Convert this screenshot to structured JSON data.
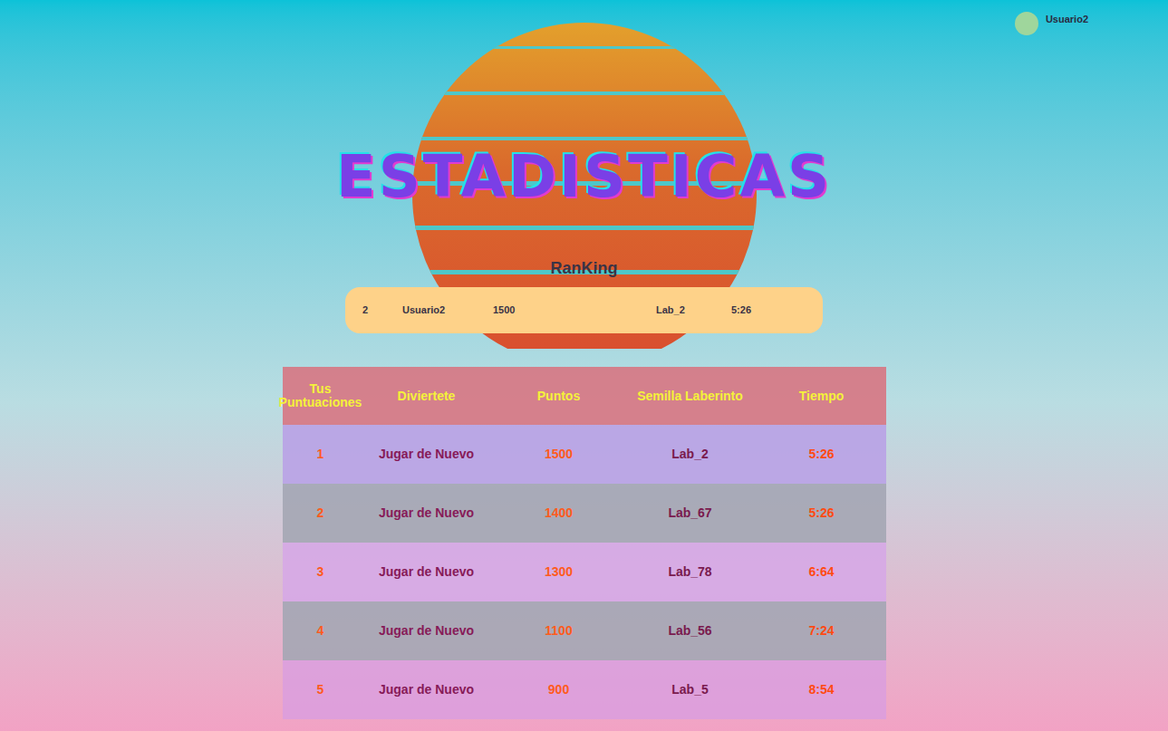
{
  "user": {
    "name": "Usuario2"
  },
  "title": "ESTADISTICAS",
  "ranking": {
    "label": "RanKing",
    "entry": {
      "position": "2",
      "user": "Usuario2",
      "points": "1500",
      "seed": "Lab_2",
      "time": "5:26"
    }
  },
  "table": {
    "columns": [
      "Tus Puntuaciones",
      "Diviertete",
      "Puntos",
      "Semilla Laberinto",
      "Tiempo"
    ],
    "rows": [
      [
        "1",
        "Jugar de Nuevo",
        "1500",
        "Lab_2",
        "5:26"
      ],
      [
        "2",
        "Jugar de Nuevo",
        "1400",
        "Lab_67",
        "5:26"
      ],
      [
        "3",
        "Jugar de Nuevo",
        "1300",
        "Lab_78",
        "6:64"
      ],
      [
        "4",
        "Jugar de Nuevo",
        "1100",
        "Lab_56",
        "7:24"
      ],
      [
        "5",
        "Jugar de Nuevo",
        "900",
        "Lab_5",
        "8:54"
      ]
    ]
  }
}
